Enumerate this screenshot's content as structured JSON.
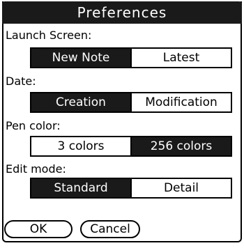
{
  "dialog": {
    "title": "Preferences"
  },
  "launch_screen": {
    "label": "Launch Screen:",
    "options": [
      "New Note",
      "Latest"
    ],
    "selected": "New Note"
  },
  "date": {
    "label": "Date:",
    "options": [
      "Creation",
      "Modification"
    ],
    "selected": "Creation"
  },
  "pen_color": {
    "label": "Pen color:",
    "options": [
      "3 colors",
      "256 colors"
    ],
    "selected": "256 colors"
  },
  "edit_mode": {
    "label": "Edit mode:",
    "options": [
      "Standard",
      "Detail"
    ],
    "selected": "Standard"
  },
  "buttons": {
    "ok": "OK",
    "cancel": "Cancel"
  }
}
